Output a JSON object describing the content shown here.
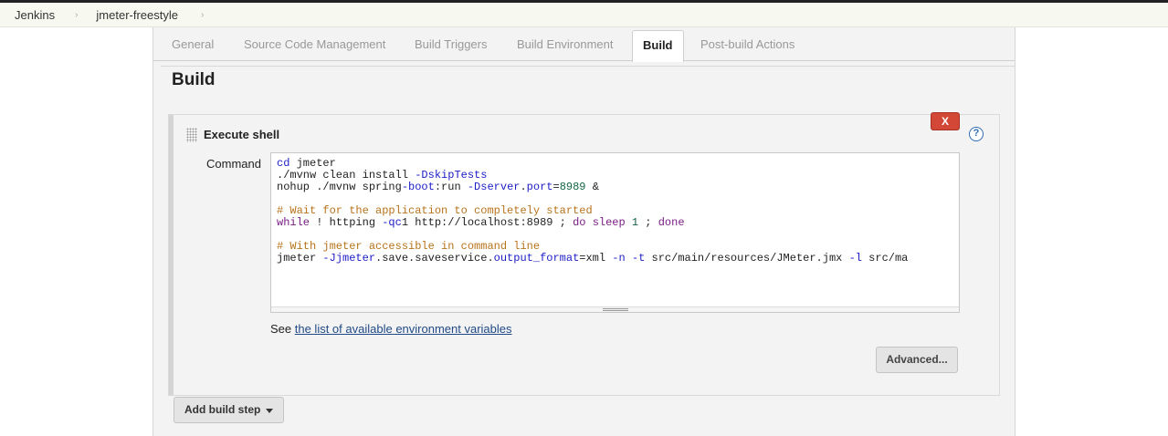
{
  "breadcrumb": {
    "root": "Jenkins",
    "job": "jmeter-freestyle",
    "separator": "›"
  },
  "tabs": [
    {
      "label": "General"
    },
    {
      "label": "Source Code Management"
    },
    {
      "label": "Build Triggers"
    },
    {
      "label": "Build Environment"
    },
    {
      "label": "Build"
    },
    {
      "label": "Post-build Actions"
    }
  ],
  "active_tab": "Build",
  "section": {
    "title": "Build"
  },
  "step": {
    "title": "Execute shell",
    "delete_label": "X",
    "help_label": "?",
    "command_label": "Command",
    "command_lines": [
      "cd jmeter",
      "./mvnw clean install -DskipTests",
      "nohup ./mvnw spring-boot:run -Dserver.port=8989 &",
      "",
      "# Wait for the application to completely started",
      "while ! httping -qc1 http://localhost:8989 ; do sleep 1 ; done",
      "",
      "# With jmeter accessible in command line",
      "jmeter -Jjmeter.save.saveservice.output_format=xml -n -t src/main/resources/JMeter.jmx -l src/ma"
    ],
    "see_prefix": "See ",
    "env_link": "the list of available environment variables",
    "advanced_label": "Advanced..."
  },
  "add_step_label": "Add build step",
  "colors": {
    "delete_button": "#d24735",
    "link": "#204a87",
    "help": "#2f6cb3"
  }
}
